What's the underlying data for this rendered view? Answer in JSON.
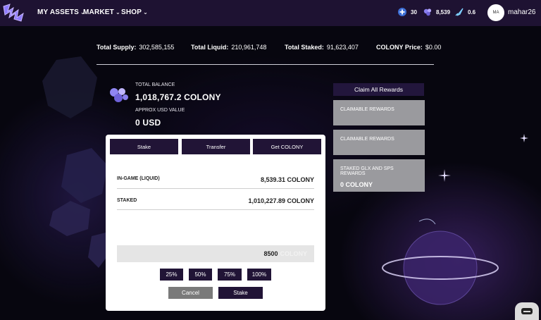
{
  "nav": {
    "items": [
      {
        "label": "MY ASSETS"
      },
      {
        "label": "MARKET"
      },
      {
        "label": "SHOP"
      }
    ],
    "stats": [
      {
        "icon": "plus-crystal-icon",
        "value": "30"
      },
      {
        "icon": "colony-token-icon",
        "value": "8,539"
      },
      {
        "icon": "rocket-icon",
        "value": "0.6"
      }
    ],
    "avatar_initials": "MA",
    "username": "mahar26"
  },
  "totals": {
    "supply_label": "Total Supply:",
    "supply_value": "302,585,155",
    "liquid_label": "Total Liquid:",
    "liquid_value": "210,961,748",
    "staked_label": "Total Staked:",
    "staked_value": "91,623,407",
    "price_label": "COLONY Price:",
    "price_value": "$0.00"
  },
  "balance": {
    "total_label": "TOTAL BALANCE",
    "total_value": "1,018,767.2 COLONY",
    "usd_label": "APPROX USD VALUE",
    "usd_value": "0 USD"
  },
  "rewards": {
    "claim_all_label": "Claim All Rewards",
    "cards": [
      {
        "label": "CLAIMABLE REWARDS",
        "value": ""
      },
      {
        "label": "CLAIMABLE REWARDS",
        "value": ""
      },
      {
        "label": "STAKED GLX AND SPS REWARDS",
        "value": "0 COLONY"
      }
    ]
  },
  "modal": {
    "tabs": [
      {
        "label": "Stake"
      },
      {
        "label": "Transfer"
      },
      {
        "label": "Get COLONY"
      }
    ],
    "rows": [
      {
        "label": "IN-GAME (LIQUID)",
        "value": "8,539.31 COLONY"
      },
      {
        "label": "STAKED",
        "value": "1,010,227.89 COLONY"
      }
    ],
    "amount": {
      "value": "8500",
      "unit": "COLONY"
    },
    "percent_buttons": [
      "25%",
      "50%",
      "75%",
      "100%"
    ],
    "cancel_label": "Cancel",
    "stake_label": "Stake"
  },
  "colors": {
    "nav_bg": "#1e1232",
    "button_dark": "#211436",
    "cancel_gray": "#7a7a7a",
    "card_gray": "#9a9a9e"
  }
}
